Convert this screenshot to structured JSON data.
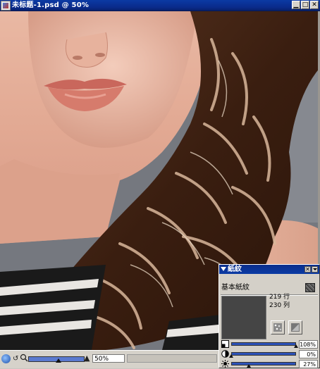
{
  "window": {
    "title": "未标题-1.psd @ 50%",
    "controls": [
      "minimize",
      "maximize",
      "close"
    ]
  },
  "statusbar": {
    "zoom_value": "50%",
    "zoom_slider_level": 0.55
  },
  "paper_palette": {
    "title": "紙紋",
    "paper_name": "基本紙紋",
    "rows": "219 行",
    "cols": "230 列",
    "sliders": [
      {
        "name": "scale",
        "icon": "scale-icon",
        "value": "108%",
        "level": 1.0
      },
      {
        "name": "contrast",
        "icon": "contrast-icon",
        "value": "0%",
        "level": 0.0
      },
      {
        "name": "brightness",
        "icon": "brightness-icon",
        "value": "27%",
        "level": 0.27
      }
    ]
  },
  "colors": {
    "title_bar": "#0b3aa4",
    "slider_track": "#2d52b8",
    "panel_bg": "#d4d0c8"
  }
}
